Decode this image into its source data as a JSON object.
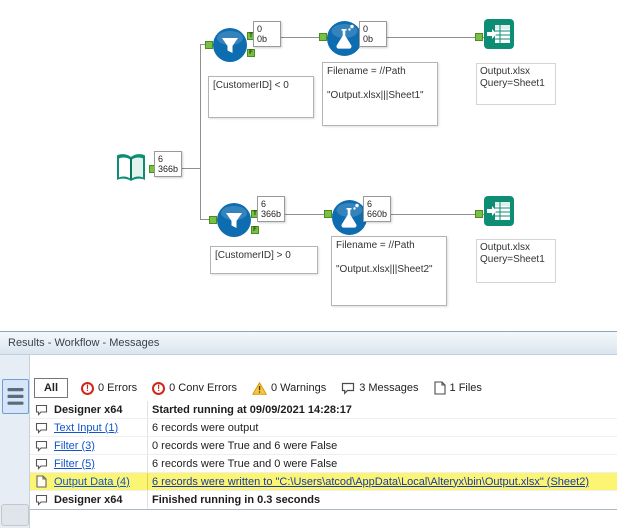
{
  "canvas": {
    "ports": {
      "t": "T",
      "f": "F"
    },
    "text_input": {
      "count": "6",
      "size": "366b"
    },
    "filter_top": {
      "count": "0",
      "size": "0b",
      "comment": "[CustomerID] < 0"
    },
    "formula_top": {
      "count": "0",
      "size": "0b",
      "comment": "Filename = //Path\n\n\"Output.xlsx|||Sheet1\""
    },
    "output_top": {
      "annotation": "Output.xlsx\nQuery=Sheet1"
    },
    "filter_bottom": {
      "count": "6",
      "size": "366b",
      "comment": "[CustomerID] > 0"
    },
    "formula_bottom": {
      "count": "6",
      "size": "660b",
      "comment": "Filename = //Path\n\n\"Output.xlsx|||Sheet2\""
    },
    "output_bottom": {
      "annotation": "Output.xlsx\nQuery=Sheet1"
    }
  },
  "results": {
    "title": "Results - Workflow - Messages",
    "toolbar": {
      "all": "All",
      "errors": "0 Errors",
      "conv_errors": "0 Conv Errors",
      "warnings": "0 Warnings",
      "messages": "3 Messages",
      "files": "1 Files"
    },
    "rows": [
      {
        "tool": "Designer x64",
        "message": "Started running at 09/09/2021 14:28:17"
      },
      {
        "tool": "Text Input (1)",
        "message": "6 records were output"
      },
      {
        "tool": "Filter (3)",
        "message": "0 records were True and 6 were False"
      },
      {
        "tool": "Filter (5)",
        "message": "6 records were True and 0 were False"
      },
      {
        "tool": "Output Data (4)",
        "message": "6 records were written to \"C:\\Users\\atcod\\AppData\\Local\\Alteryx\\bin\\Output.xlsx\" (Sheet2)"
      },
      {
        "tool": "Designer x64",
        "message": "Finished running in 0.3 seconds"
      }
    ]
  }
}
